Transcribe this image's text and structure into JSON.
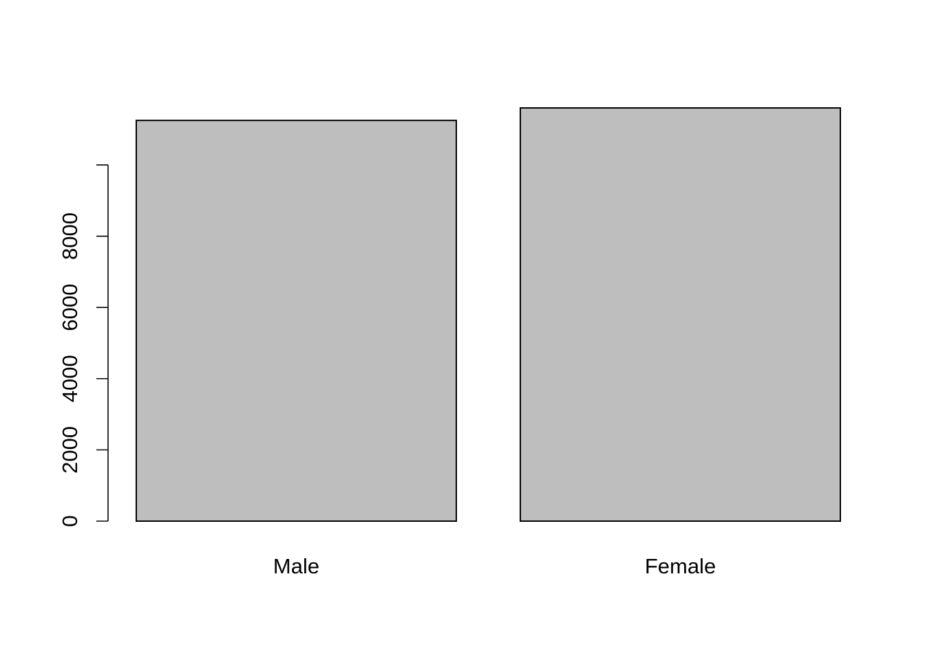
{
  "chart_data": {
    "type": "bar",
    "title": "",
    "xlabel": "",
    "ylabel": "",
    "categories": [
      "Male",
      "Female"
    ],
    "values": [
      11250,
      11600
    ],
    "ylim": [
      0,
      11600
    ],
    "y_ticks": [
      0,
      2000,
      4000,
      6000,
      8000
    ],
    "y_tick_labels": [
      "0",
      "2000",
      "4000",
      "6000",
      "8000"
    ],
    "bar_color": "#bebebe",
    "border_color": "#000000",
    "grid": false
  }
}
